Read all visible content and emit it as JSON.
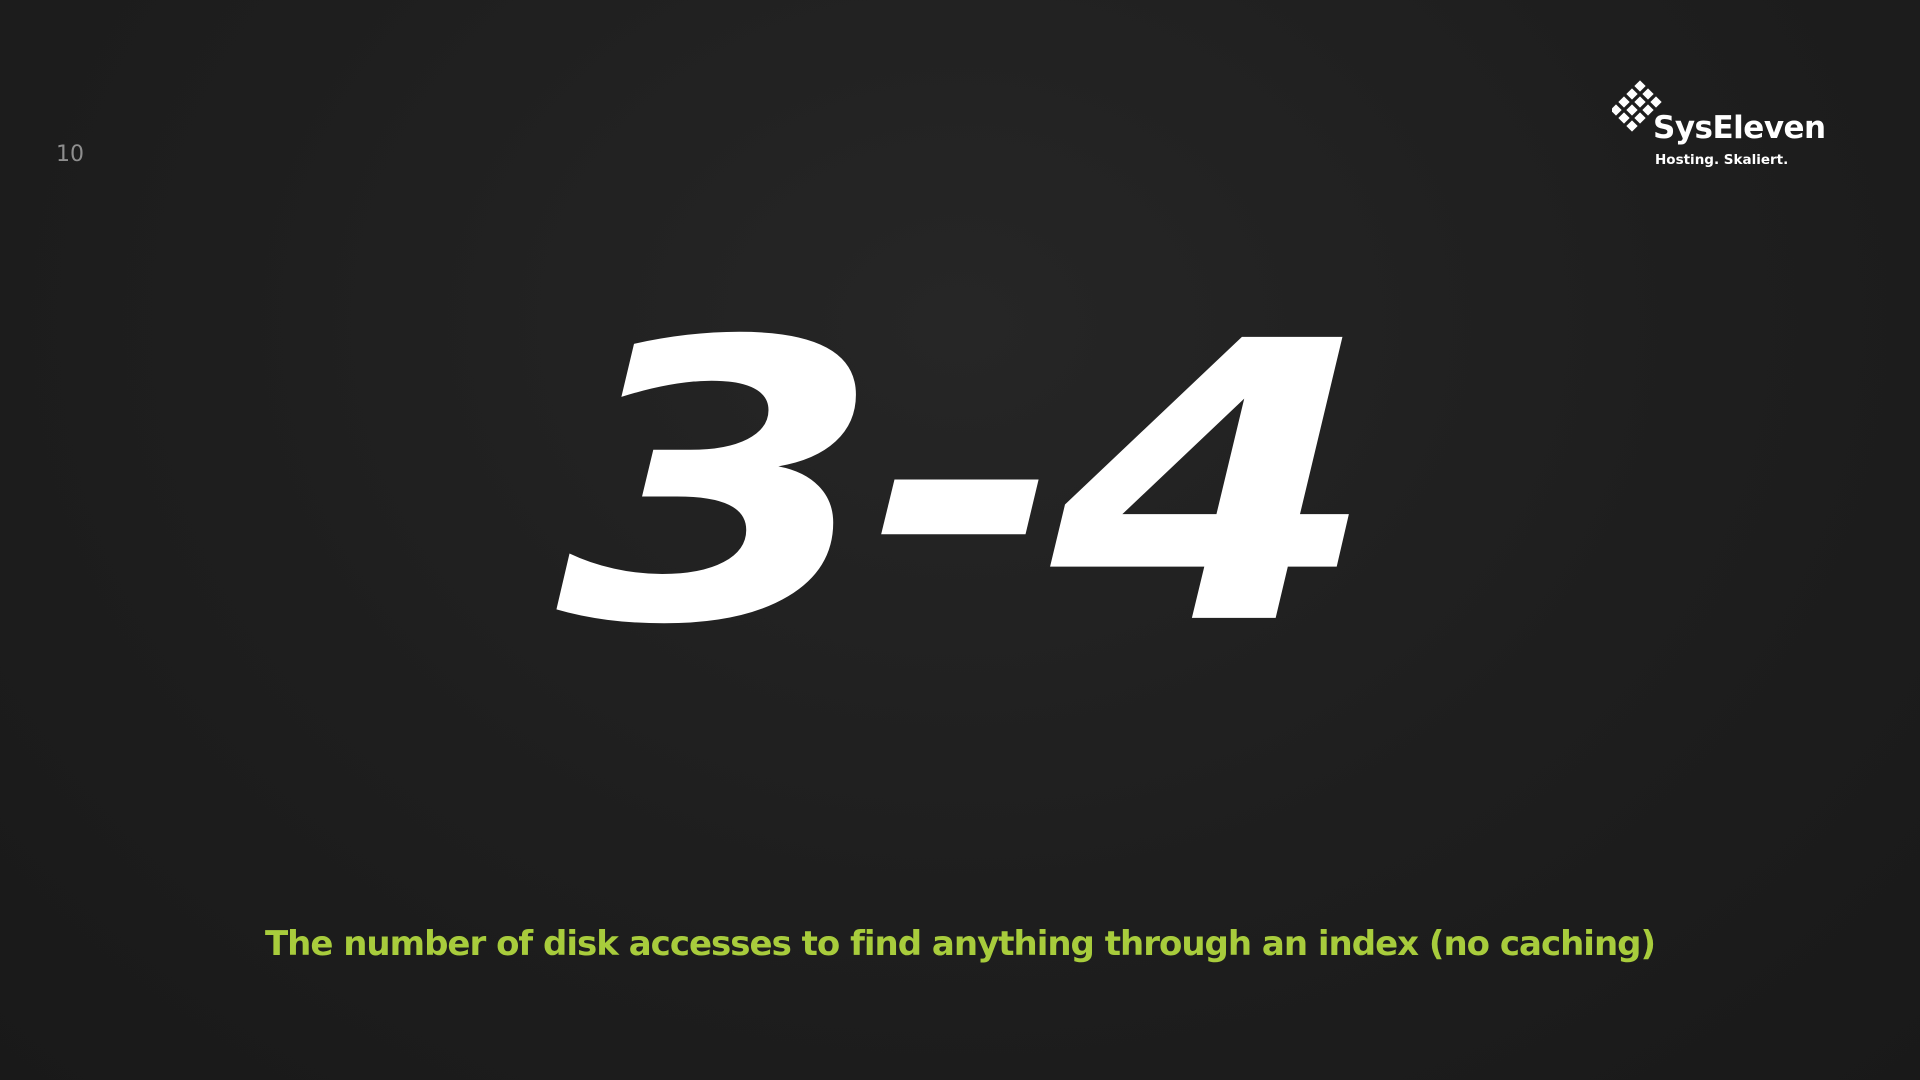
{
  "slide": {
    "number": "10",
    "headline": "3-4",
    "caption": "The number of disk accesses to find anything through an index (no caching)"
  },
  "logo": {
    "icon": "diamond-grid-logo-icon",
    "name": "SysEleven",
    "tagline": "Hosting. Skaliert."
  },
  "colors": {
    "background": "#1e1e1e",
    "headline": "#ffffff",
    "caption": "#a8cc3c",
    "slide_number": "#8e8e8e"
  }
}
